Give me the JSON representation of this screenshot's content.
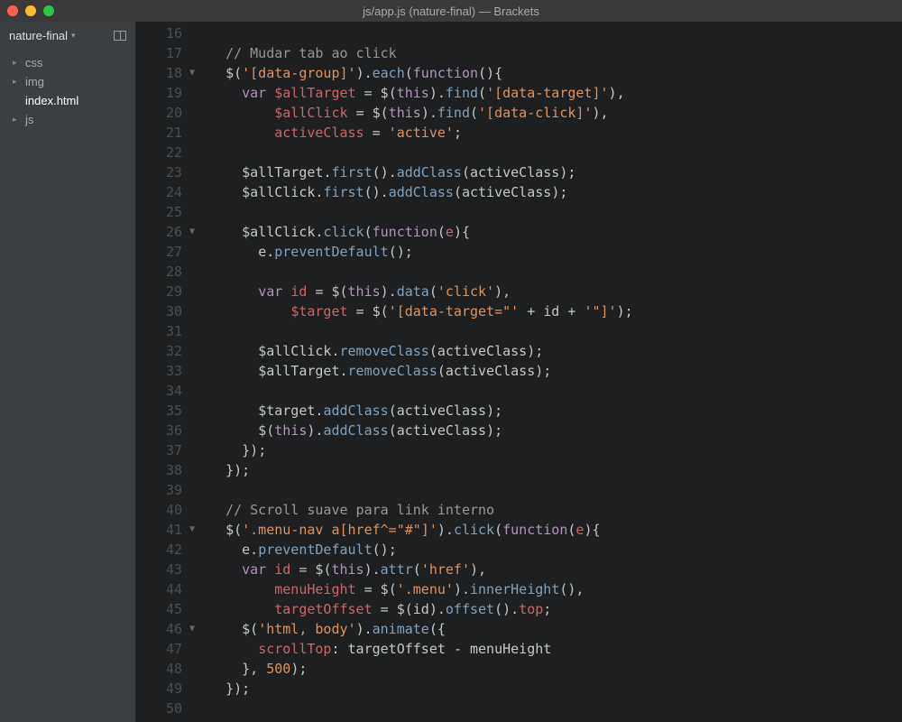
{
  "title": "js/app.js (nature-final) — Brackets",
  "project": "nature-final",
  "files": [
    {
      "name": "css",
      "type": "folder"
    },
    {
      "name": "img",
      "type": "folder"
    },
    {
      "name": "index.html",
      "type": "file",
      "active": true
    },
    {
      "name": "js",
      "type": "folder"
    }
  ],
  "lines": [
    {
      "n": 16,
      "fold": "",
      "tokens": []
    },
    {
      "n": 17,
      "fold": "",
      "tokens": [
        [
          "  ",
          "p"
        ],
        [
          "// Mudar tab ao click",
          "comment"
        ]
      ]
    },
    {
      "n": 18,
      "fold": "▼",
      "tokens": [
        [
          "  ",
          "p"
        ],
        [
          "$",
          "i"
        ],
        [
          "(",
          "p"
        ],
        [
          "'[data-group]'",
          "string"
        ],
        [
          ")",
          "p"
        ],
        [
          ".",
          "p"
        ],
        [
          "each",
          "method"
        ],
        [
          "(",
          "p"
        ],
        [
          "function",
          "func"
        ],
        [
          "()",
          "p"
        ],
        [
          "{",
          "p"
        ]
      ]
    },
    {
      "n": 19,
      "fold": "",
      "tokens": [
        [
          "    ",
          "p"
        ],
        [
          "var",
          "keyword"
        ],
        [
          " ",
          "p"
        ],
        [
          "$allTarget",
          "var"
        ],
        [
          " ",
          "p"
        ],
        [
          "=",
          "p"
        ],
        [
          " ",
          "p"
        ],
        [
          "$",
          "i"
        ],
        [
          "(",
          "p"
        ],
        [
          "this",
          "this"
        ],
        [
          ")",
          "p"
        ],
        [
          ".",
          "p"
        ],
        [
          "find",
          "method"
        ],
        [
          "(",
          "p"
        ],
        [
          "'[data-target]'",
          "string"
        ],
        [
          ")",
          "p"
        ],
        [
          ",",
          "p"
        ]
      ]
    },
    {
      "n": 20,
      "fold": "",
      "tokens": [
        [
          "        ",
          "p"
        ],
        [
          "$allClick",
          "var"
        ],
        [
          " ",
          "p"
        ],
        [
          "=",
          "p"
        ],
        [
          " ",
          "p"
        ],
        [
          "$",
          "i"
        ],
        [
          "(",
          "p"
        ],
        [
          "this",
          "this"
        ],
        [
          ")",
          "p"
        ],
        [
          ".",
          "p"
        ],
        [
          "find",
          "method"
        ],
        [
          "(",
          "p"
        ],
        [
          "'[data-click]'",
          "string"
        ],
        [
          ")",
          "p"
        ],
        [
          ",",
          "p"
        ]
      ]
    },
    {
      "n": 21,
      "fold": "",
      "tokens": [
        [
          "        ",
          "p"
        ],
        [
          "activeClass",
          "var"
        ],
        [
          " ",
          "p"
        ],
        [
          "=",
          "p"
        ],
        [
          " ",
          "p"
        ],
        [
          "'active'",
          "string"
        ],
        [
          ";",
          "p"
        ]
      ]
    },
    {
      "n": 22,
      "fold": "",
      "tokens": []
    },
    {
      "n": 23,
      "fold": "",
      "tokens": [
        [
          "    ",
          "p"
        ],
        [
          "$allTarget",
          "i"
        ],
        [
          ".",
          "p"
        ],
        [
          "first",
          "method"
        ],
        [
          "()",
          "p"
        ],
        [
          ".",
          "p"
        ],
        [
          "addClass",
          "method"
        ],
        [
          "(",
          "p"
        ],
        [
          "activeClass",
          "i"
        ],
        [
          ")",
          "p"
        ],
        [
          ";",
          "p"
        ]
      ]
    },
    {
      "n": 24,
      "fold": "",
      "tokens": [
        [
          "    ",
          "p"
        ],
        [
          "$allClick",
          "i"
        ],
        [
          ".",
          "p"
        ],
        [
          "first",
          "method"
        ],
        [
          "()",
          "p"
        ],
        [
          ".",
          "p"
        ],
        [
          "addClass",
          "method"
        ],
        [
          "(",
          "p"
        ],
        [
          "activeClass",
          "i"
        ],
        [
          ")",
          "p"
        ],
        [
          ";",
          "p"
        ]
      ]
    },
    {
      "n": 25,
      "fold": "",
      "tokens": []
    },
    {
      "n": 26,
      "fold": "▼",
      "tokens": [
        [
          "    ",
          "p"
        ],
        [
          "$allClick",
          "i"
        ],
        [
          ".",
          "p"
        ],
        [
          "click",
          "method"
        ],
        [
          "(",
          "p"
        ],
        [
          "function",
          "func"
        ],
        [
          "(",
          "p"
        ],
        [
          "e",
          "var"
        ],
        [
          ")",
          "p"
        ],
        [
          "{",
          "p"
        ]
      ]
    },
    {
      "n": 27,
      "fold": "",
      "tokens": [
        [
          "      ",
          "p"
        ],
        [
          "e",
          "i"
        ],
        [
          ".",
          "p"
        ],
        [
          "preventDefault",
          "method"
        ],
        [
          "()",
          "p"
        ],
        [
          ";",
          "p"
        ]
      ]
    },
    {
      "n": 28,
      "fold": "",
      "tokens": []
    },
    {
      "n": 29,
      "fold": "",
      "tokens": [
        [
          "      ",
          "p"
        ],
        [
          "var",
          "keyword"
        ],
        [
          " ",
          "p"
        ],
        [
          "id",
          "var"
        ],
        [
          " ",
          "p"
        ],
        [
          "=",
          "p"
        ],
        [
          " ",
          "p"
        ],
        [
          "$",
          "i"
        ],
        [
          "(",
          "p"
        ],
        [
          "this",
          "this"
        ],
        [
          ")",
          "p"
        ],
        [
          ".",
          "p"
        ],
        [
          "data",
          "method"
        ],
        [
          "(",
          "p"
        ],
        [
          "'click'",
          "string"
        ],
        [
          ")",
          "p"
        ],
        [
          ",",
          "p"
        ]
      ]
    },
    {
      "n": 30,
      "fold": "",
      "tokens": [
        [
          "          ",
          "p"
        ],
        [
          "$target",
          "var"
        ],
        [
          " ",
          "p"
        ],
        [
          "=",
          "p"
        ],
        [
          " ",
          "p"
        ],
        [
          "$",
          "i"
        ],
        [
          "(",
          "p"
        ],
        [
          "'[data-target=\"'",
          "string"
        ],
        [
          " ",
          "p"
        ],
        [
          "+",
          "p"
        ],
        [
          " ",
          "p"
        ],
        [
          "id",
          "i"
        ],
        [
          " ",
          "p"
        ],
        [
          "+",
          "p"
        ],
        [
          " ",
          "p"
        ],
        [
          "'\"]'",
          "string"
        ],
        [
          ")",
          "p"
        ],
        [
          ";",
          "p"
        ]
      ]
    },
    {
      "n": 31,
      "fold": "",
      "tokens": []
    },
    {
      "n": 32,
      "fold": "",
      "tokens": [
        [
          "      ",
          "p"
        ],
        [
          "$allClick",
          "i"
        ],
        [
          ".",
          "p"
        ],
        [
          "removeClass",
          "method"
        ],
        [
          "(",
          "p"
        ],
        [
          "activeClass",
          "i"
        ],
        [
          ")",
          "p"
        ],
        [
          ";",
          "p"
        ]
      ]
    },
    {
      "n": 33,
      "fold": "",
      "tokens": [
        [
          "      ",
          "p"
        ],
        [
          "$allTarget",
          "i"
        ],
        [
          ".",
          "p"
        ],
        [
          "removeClass",
          "method"
        ],
        [
          "(",
          "p"
        ],
        [
          "activeClass",
          "i"
        ],
        [
          ")",
          "p"
        ],
        [
          ";",
          "p"
        ]
      ]
    },
    {
      "n": 34,
      "fold": "",
      "tokens": []
    },
    {
      "n": 35,
      "fold": "",
      "tokens": [
        [
          "      ",
          "p"
        ],
        [
          "$target",
          "i"
        ],
        [
          ".",
          "p"
        ],
        [
          "addClass",
          "method"
        ],
        [
          "(",
          "p"
        ],
        [
          "activeClass",
          "i"
        ],
        [
          ")",
          "p"
        ],
        [
          ";",
          "p"
        ]
      ]
    },
    {
      "n": 36,
      "fold": "",
      "tokens": [
        [
          "      ",
          "p"
        ],
        [
          "$",
          "i"
        ],
        [
          "(",
          "p"
        ],
        [
          "this",
          "this"
        ],
        [
          ")",
          "p"
        ],
        [
          ".",
          "p"
        ],
        [
          "addClass",
          "method"
        ],
        [
          "(",
          "p"
        ],
        [
          "activeClass",
          "i"
        ],
        [
          ")",
          "p"
        ],
        [
          ";",
          "p"
        ]
      ]
    },
    {
      "n": 37,
      "fold": "",
      "tokens": [
        [
          "    ",
          "p"
        ],
        [
          "})",
          "p"
        ],
        [
          ";",
          "p"
        ]
      ]
    },
    {
      "n": 38,
      "fold": "",
      "tokens": [
        [
          "  ",
          "p"
        ],
        [
          "})",
          "p"
        ],
        [
          ";",
          "p"
        ]
      ]
    },
    {
      "n": 39,
      "fold": "",
      "tokens": []
    },
    {
      "n": 40,
      "fold": "",
      "tokens": [
        [
          "  ",
          "p"
        ],
        [
          "// Scroll suave para link interno",
          "comment"
        ]
      ]
    },
    {
      "n": 41,
      "fold": "▼",
      "tokens": [
        [
          "  ",
          "p"
        ],
        [
          "$",
          "i"
        ],
        [
          "(",
          "p"
        ],
        [
          "'.menu-nav a[href^=\"#\"]'",
          "string"
        ],
        [
          ")",
          "p"
        ],
        [
          ".",
          "p"
        ],
        [
          "click",
          "method"
        ],
        [
          "(",
          "p"
        ],
        [
          "function",
          "func"
        ],
        [
          "(",
          "p"
        ],
        [
          "e",
          "var"
        ],
        [
          ")",
          "p"
        ],
        [
          "{",
          "p"
        ]
      ]
    },
    {
      "n": 42,
      "fold": "",
      "tokens": [
        [
          "    ",
          "p"
        ],
        [
          "e",
          "i"
        ],
        [
          ".",
          "p"
        ],
        [
          "preventDefault",
          "method"
        ],
        [
          "()",
          "p"
        ],
        [
          ";",
          "p"
        ]
      ]
    },
    {
      "n": 43,
      "fold": "",
      "tokens": [
        [
          "    ",
          "p"
        ],
        [
          "var",
          "keyword"
        ],
        [
          " ",
          "p"
        ],
        [
          "id",
          "var"
        ],
        [
          " ",
          "p"
        ],
        [
          "=",
          "p"
        ],
        [
          " ",
          "p"
        ],
        [
          "$",
          "i"
        ],
        [
          "(",
          "p"
        ],
        [
          "this",
          "this"
        ],
        [
          ")",
          "p"
        ],
        [
          ".",
          "p"
        ],
        [
          "attr",
          "method"
        ],
        [
          "(",
          "p"
        ],
        [
          "'href'",
          "string"
        ],
        [
          ")",
          "p"
        ],
        [
          ",",
          "p"
        ]
      ]
    },
    {
      "n": 44,
      "fold": "",
      "tokens": [
        [
          "        ",
          "p"
        ],
        [
          "menuHeight",
          "var"
        ],
        [
          " ",
          "p"
        ],
        [
          "=",
          "p"
        ],
        [
          " ",
          "p"
        ],
        [
          "$",
          "i"
        ],
        [
          "(",
          "p"
        ],
        [
          "'.menu'",
          "string"
        ],
        [
          ")",
          "p"
        ],
        [
          ".",
          "p"
        ],
        [
          "innerHeight",
          "method"
        ],
        [
          "()",
          "p"
        ],
        [
          ",",
          "p"
        ]
      ]
    },
    {
      "n": 45,
      "fold": "",
      "tokens": [
        [
          "        ",
          "p"
        ],
        [
          "targetOffset",
          "var"
        ],
        [
          " ",
          "p"
        ],
        [
          "=",
          "p"
        ],
        [
          " ",
          "p"
        ],
        [
          "$",
          "i"
        ],
        [
          "(",
          "p"
        ],
        [
          "id",
          "i"
        ],
        [
          ")",
          "p"
        ],
        [
          ".",
          "p"
        ],
        [
          "offset",
          "method"
        ],
        [
          "()",
          "p"
        ],
        [
          ".",
          "p"
        ],
        [
          "top",
          "prop"
        ],
        [
          ";",
          "p"
        ]
      ]
    },
    {
      "n": 46,
      "fold": "▼",
      "tokens": [
        [
          "    ",
          "p"
        ],
        [
          "$",
          "i"
        ],
        [
          "(",
          "p"
        ],
        [
          "'html, body'",
          "string"
        ],
        [
          ")",
          "p"
        ],
        [
          ".",
          "p"
        ],
        [
          "animate",
          "method"
        ],
        [
          "(",
          "p"
        ],
        [
          "{",
          "p"
        ]
      ]
    },
    {
      "n": 47,
      "fold": "",
      "tokens": [
        [
          "      ",
          "p"
        ],
        [
          "scrollTop",
          "prop"
        ],
        [
          ":",
          "p"
        ],
        [
          " ",
          "p"
        ],
        [
          "targetOffset",
          "i"
        ],
        [
          " ",
          "p"
        ],
        [
          "-",
          "p"
        ],
        [
          " ",
          "p"
        ],
        [
          "menuHeight",
          "i"
        ]
      ]
    },
    {
      "n": 48,
      "fold": "",
      "tokens": [
        [
          "    ",
          "p"
        ],
        [
          "}",
          "p"
        ],
        [
          ",",
          "p"
        ],
        [
          " ",
          "p"
        ],
        [
          "500",
          "num"
        ],
        [
          ")",
          "p"
        ],
        [
          ";",
          "p"
        ]
      ]
    },
    {
      "n": 49,
      "fold": "",
      "tokens": [
        [
          "  ",
          "p"
        ],
        [
          "})",
          "p"
        ],
        [
          ";",
          "p"
        ]
      ]
    },
    {
      "n": 50,
      "fold": "",
      "tokens": []
    }
  ]
}
